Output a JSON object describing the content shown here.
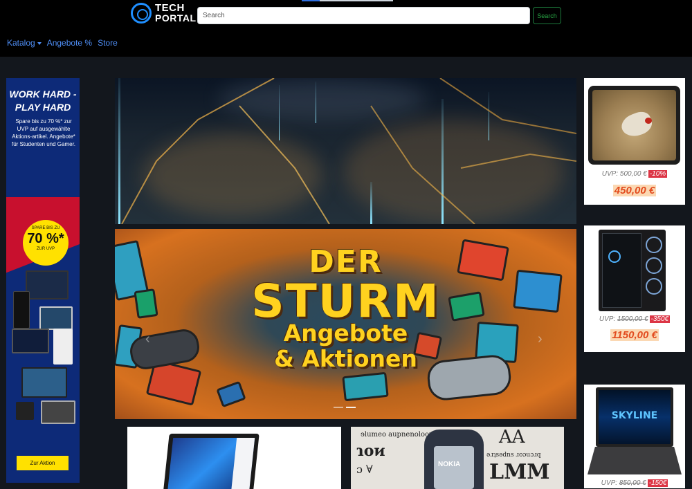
{
  "brand": {
    "line1": "TECH",
    "line2": "PORTAL"
  },
  "search": {
    "placeholder": "Search",
    "button": "Search"
  },
  "nav": [
    {
      "label": "Katalog",
      "dropdown": true
    },
    {
      "label": "Angebote %"
    },
    {
      "label": "Store"
    }
  ],
  "side_ad": {
    "headline1": "WORK HARD -",
    "headline2": "PLAY HARD",
    "text": "Spare bis zu 70 %* zur UVP auf ausgewählte Aktions-artikel. Angebote* für Studenten und Gamer.",
    "badge_top": "SPARE BIS ZU",
    "badge_value": "70 %*",
    "badge_bottom": "ZUR UVP",
    "cta": "Zur Aktion"
  },
  "carousel": {
    "slide2_line1": "DER",
    "slide2_line2": "STURM",
    "slide2_line3": "Angebote",
    "slide2_line4": "& Aktionen",
    "prev": "‹",
    "next": "›"
  },
  "tiles": {
    "nokia_logo": "NOKIA",
    "skyline": "SKYLINE"
  },
  "products": [
    {
      "uvp_label": "UVP:",
      "uvp": "500,00 €",
      "discount": "-10%",
      "price": "450,00 €"
    },
    {
      "uvp_label": "UVP:",
      "uvp": "1500,00 €",
      "discount": "-350€",
      "price": "1150,00 €"
    },
    {
      "uvp_label": "UVP:",
      "uvp": "850,00 €",
      "discount": "-150€",
      "price": ""
    }
  ],
  "colors": {
    "accent": "#4f8ff7",
    "search_green": "#28a745",
    "price": "#e24b1e",
    "discount": "#dc3545",
    "badge": "#ffe100"
  }
}
